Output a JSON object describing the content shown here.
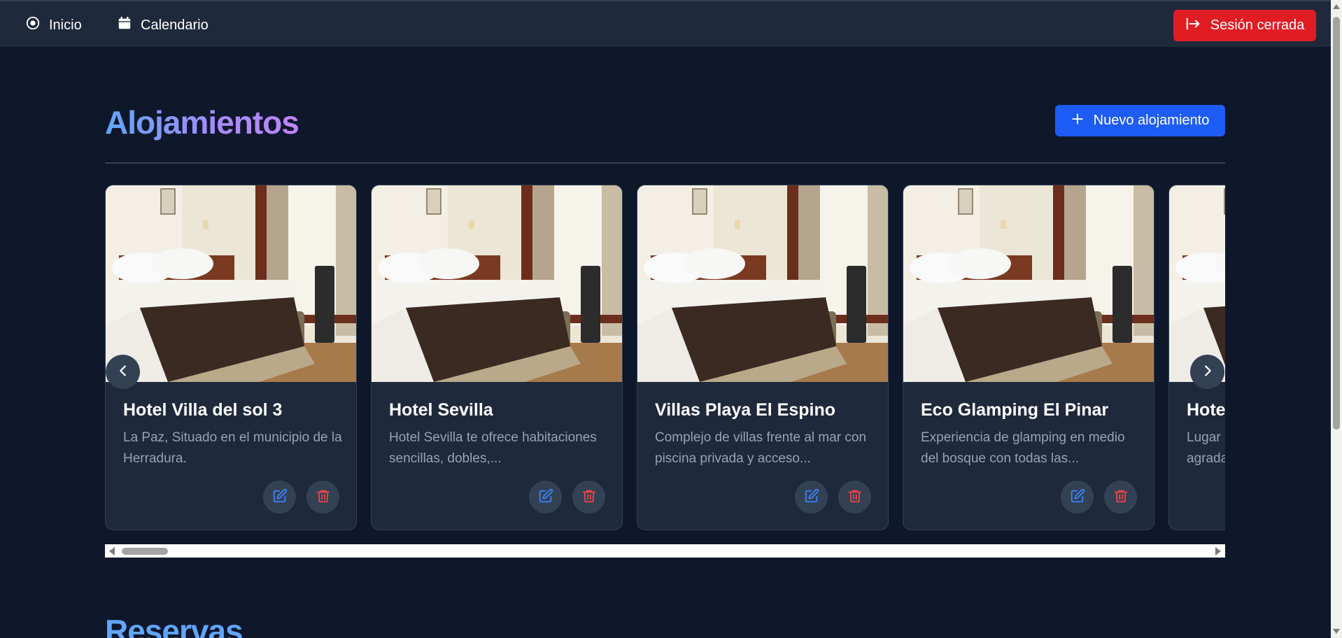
{
  "nav": {
    "home_label": "Inicio",
    "home_icon": "target-circle-icon",
    "calendar_label": "Calendario",
    "calendar_icon": "calendar-icon",
    "logout_label": "Sesión cerrada",
    "logout_icon": "logout-arrow-icon"
  },
  "colors": {
    "background": "#0f172a",
    "topbar": "#1e293b",
    "logout": "#e11d24",
    "primary": "#1d5cf5",
    "edit_icon": "#3b82f6",
    "delete_icon": "#ef4444"
  },
  "accommodations": {
    "title": "Alojamientos",
    "new_button_label": "Nuevo alojamiento",
    "new_button_icon": "plus-icon",
    "cards": [
      {
        "name": "Hotel Villa del sol 3",
        "description": "La Paz, Situado en el municipio de la Herradura."
      },
      {
        "name": "Hotel Sevilla",
        "description": "Hotel Sevilla te ofrece habitaciones sencillas, dobles,..."
      },
      {
        "name": "Villas Playa El Espino",
        "description": "Complejo de villas frente al mar con piscina privada y acceso..."
      },
      {
        "name": "Eco Glamping El Pinar",
        "description": "Experiencia de glamping en medio del bosque con todas las..."
      },
      {
        "name": "Hote",
        "description": "Lugar agrada"
      }
    ]
  },
  "reservations": {
    "title": "Reservas"
  }
}
